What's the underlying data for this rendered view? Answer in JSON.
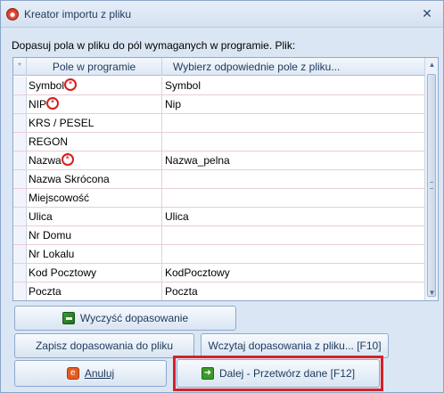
{
  "window": {
    "title": "Kreator importu z pliku",
    "close_glyph": "✕"
  },
  "instruction": "Dopasuj pola w pliku do pól wymaganych w programie. Plik:",
  "grid": {
    "header_star": "*",
    "columns": [
      "Pole w programie",
      "Wybierz odpowiednie pole z pliku..."
    ],
    "required_marker": "*",
    "rows": [
      {
        "field": "Symbol",
        "required": true,
        "value": "Symbol"
      },
      {
        "field": "NIP",
        "required": true,
        "value": "Nip"
      },
      {
        "field": "KRS / PESEL",
        "required": false,
        "value": ""
      },
      {
        "field": "REGON",
        "required": false,
        "value": ""
      },
      {
        "field": "Nazwa",
        "required": true,
        "value": "Nazwa_pelna"
      },
      {
        "field": "Nazwa Skrócona",
        "required": false,
        "value": ""
      },
      {
        "field": "Miejscowość",
        "required": false,
        "value": ""
      },
      {
        "field": "Ulica",
        "required": false,
        "value": "Ulica"
      },
      {
        "field": "Nr Domu",
        "required": false,
        "value": ""
      },
      {
        "field": "Nr Lokalu",
        "required": false,
        "value": ""
      },
      {
        "field": "Kod Pocztowy",
        "required": false,
        "value": "KodPocztowy"
      },
      {
        "field": "Poczta",
        "required": false,
        "value": "Poczta"
      }
    ],
    "scroll_up": "▲",
    "scroll_down": "▼"
  },
  "buttons": {
    "clear": "Wyczyść dopasowanie",
    "save": "Zapisz dopasowania do pliku",
    "load": "Wczytaj dopasowania z pliku... [F10]",
    "cancel": "Anuluj",
    "next": "Dalej - Przetwórz dane [F12]"
  },
  "icons": {
    "app": "app-logo-icon",
    "clear": "eraser-icon",
    "cancel": "cancel-icon",
    "next": "arrow-right-icon"
  },
  "colors": {
    "required_marker": "#d41f1f",
    "highlight": "#d5212a",
    "window_bg": "#dbe6f4"
  }
}
